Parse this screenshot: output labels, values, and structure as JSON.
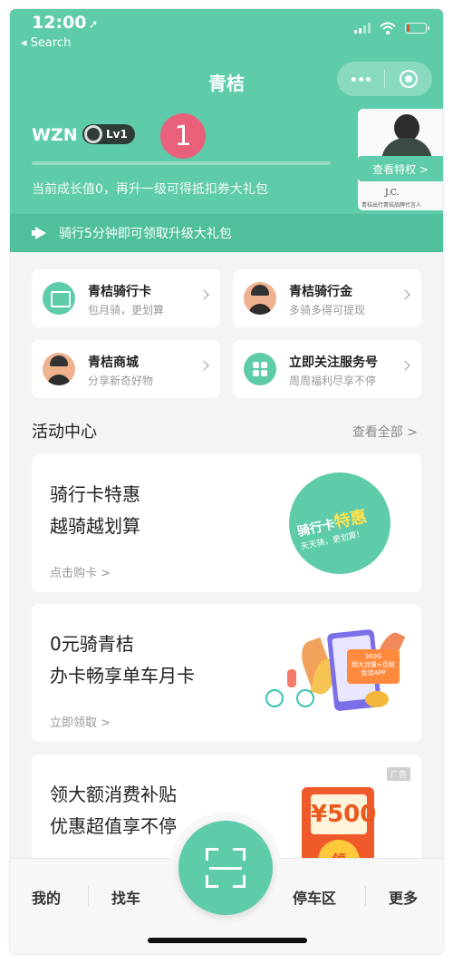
{
  "status_bar": {
    "time": "12:00",
    "location_glyph": "➚",
    "back_label": "◂ Search",
    "signal_bars": 4,
    "battery_level": 0.1
  },
  "nav": {
    "title": "青桔",
    "more_icon": "more-dots-icon",
    "close_icon": "target-icon"
  },
  "user": {
    "name": "WZN",
    "level": "Lv1",
    "bubble_number": "1",
    "growth_progress": 0.0,
    "growth_text": "当前成长值0，再升一级可得抵扣券大礼包",
    "perks_button": "查看特权 >",
    "endorser_sign": "J.C.",
    "endorser_caption": "青桔出行青桔品牌代言人"
  },
  "notice": {
    "icon": "megaphone-icon",
    "text": "骑行5分钟即可领取升级大礼包"
  },
  "quick_cards": [
    {
      "title": "青桔骑行卡",
      "subtitle": "包月骑，更划算",
      "icon": "card-icon"
    },
    {
      "title": "青桔骑行金",
      "subtitle": "多骑多得可提现",
      "icon": "avatar-icon"
    },
    {
      "title": "青桔商城",
      "subtitle": "分享新奇好物",
      "icon": "avatar-icon"
    },
    {
      "title": "立即关注服务号",
      "subtitle": "周周福利尽享不停",
      "icon": "grid-icon"
    }
  ],
  "activity": {
    "title": "活动中心",
    "view_all": "查看全部 >"
  },
  "promos": [
    {
      "line1": "骑行卡特惠",
      "line2": "越骑越划算",
      "link": "点击购卡 >",
      "badge_main": "骑行卡",
      "badge_hi": "特惠",
      "badge_sub": "天天骑，更划算!"
    },
    {
      "line1": "0元骑青桔",
      "line2": "办卡畅享单车月卡",
      "link": "立即领取 >",
      "ticket_line1": "360G",
      "ticket_line2": "超大流量+百款",
      "ticket_line3": "免流APP"
    },
    {
      "line1": "领大额消费补贴",
      "line2": "优惠超值享不停",
      "ad_tag": "广告",
      "amount": "¥500",
      "coin_text": "领"
    }
  ],
  "tabbar": {
    "tabs": [
      "我的",
      "找车",
      "停车区",
      "更多"
    ],
    "scan_icon": "scan-icon"
  },
  "colors": {
    "brand_green": "#5ecbaa",
    "notice_green": "#4fbf9d",
    "bubble_pink": "#e8607a",
    "highlight_yellow": "#ffe14d"
  }
}
